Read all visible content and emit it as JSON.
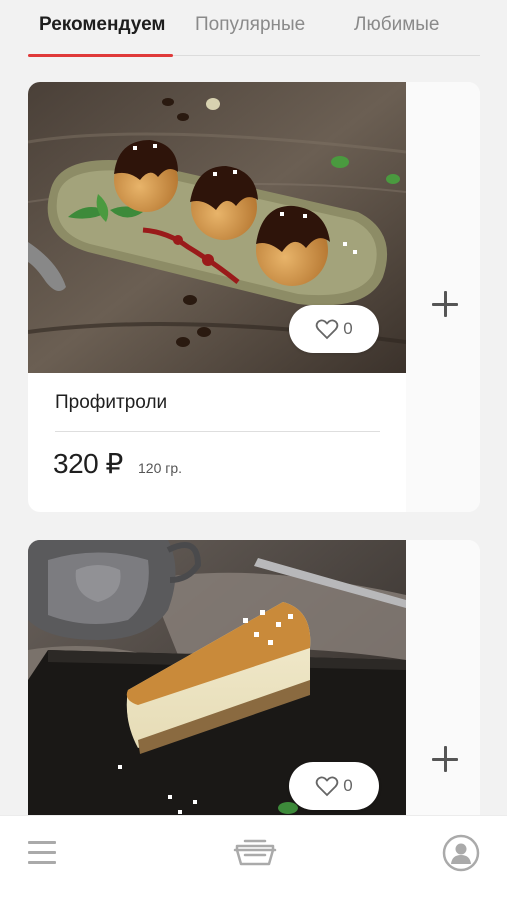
{
  "tabs": [
    {
      "label": "Рекомендуем",
      "active": true
    },
    {
      "label": "Популярные",
      "active": false
    },
    {
      "label": "Любимые",
      "active": false
    }
  ],
  "products": [
    {
      "title": "Профитроли",
      "price": "320 ₽",
      "weight": "120 гр.",
      "likes": "0",
      "image": "profiteroles-photo"
    },
    {
      "title": "",
      "price": "",
      "weight": "",
      "likes": "0",
      "image": "cheesecake-photo"
    }
  ],
  "bottom_nav": {
    "menu_icon": "hamburger-menu-icon",
    "basket_icon": "basket-icon",
    "profile_icon": "user-profile-icon"
  },
  "colors": {
    "accent": "#e03a3a",
    "background": "#f2f2f2",
    "card": "#ffffff",
    "icon": "#aaaaaa"
  }
}
